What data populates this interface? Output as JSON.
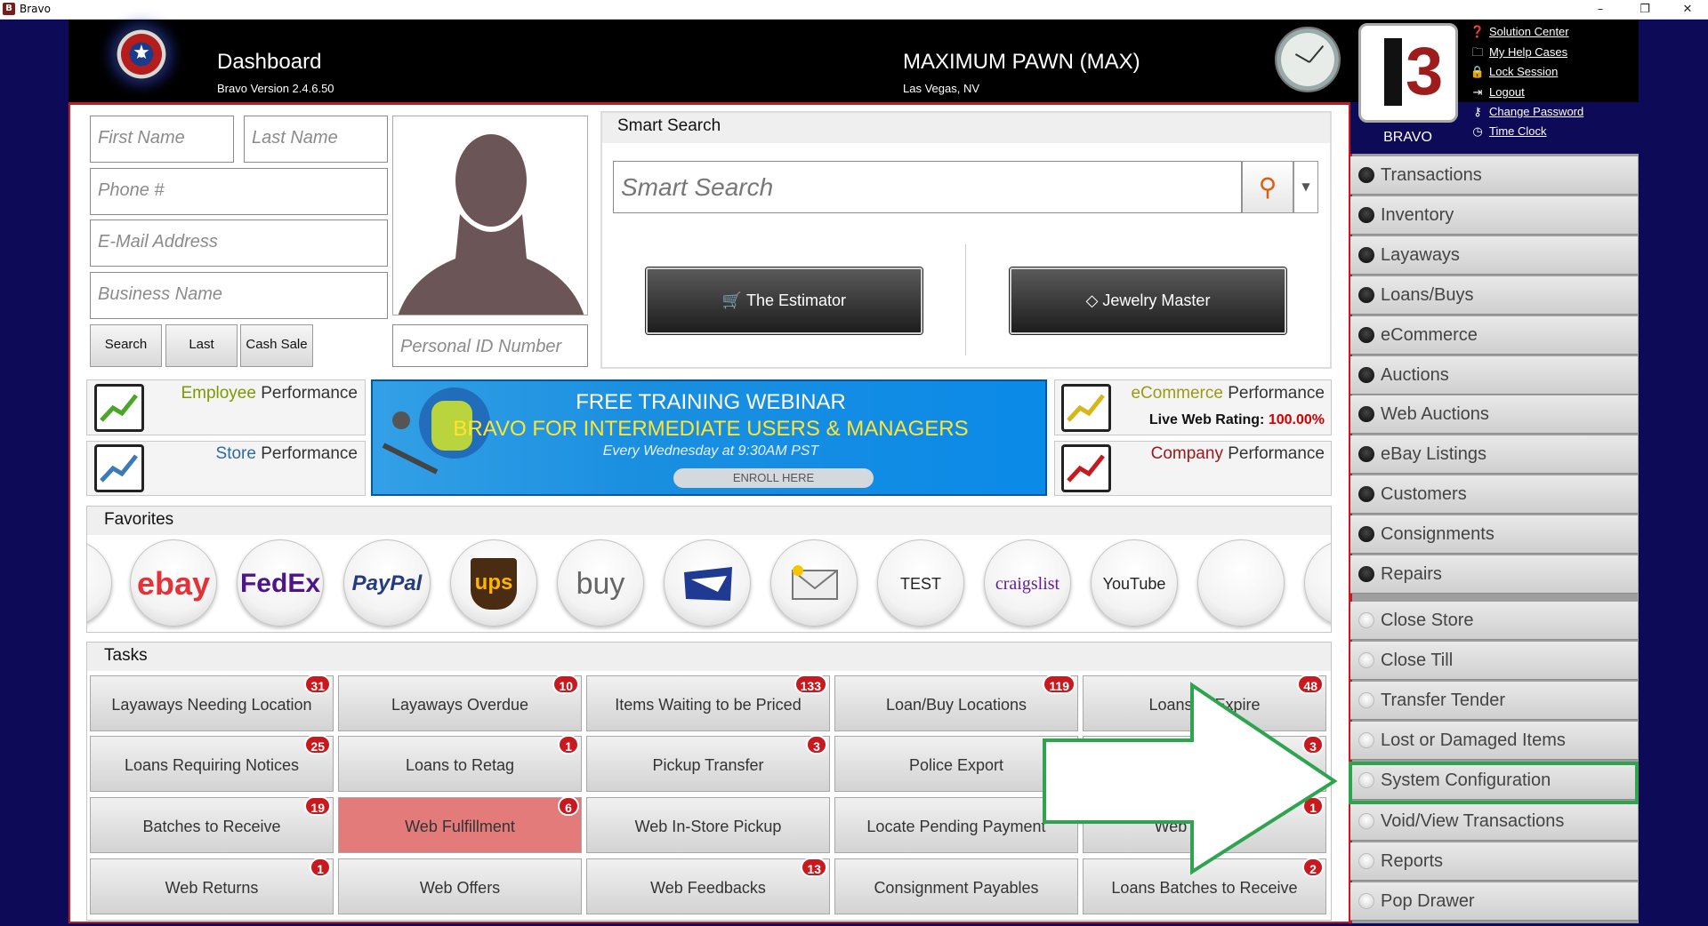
{
  "window": {
    "title": "Bravo",
    "minimize": "–",
    "restore": "❐",
    "close": "✕"
  },
  "header": {
    "dashboard_title": "Dashboard",
    "version": "Bravo Version 2.4.6.50",
    "store_name": "MAXIMUM PAWN (MAX)",
    "store_location": "Las Vegas, NV",
    "brand_label": "BRAVO",
    "links": [
      {
        "label": "Solution Center",
        "icon": "question-icon"
      },
      {
        "label": "My Help Cases",
        "icon": "folder-icon"
      },
      {
        "label": "Lock Session",
        "icon": "lock-icon"
      },
      {
        "label": "Logout",
        "icon": "logout-icon"
      },
      {
        "label": "Change Password",
        "icon": "key-icon"
      },
      {
        "label": "Time Clock",
        "icon": "clock-icon"
      }
    ]
  },
  "customer_search": {
    "first_name_placeholder": "First Name",
    "last_name_placeholder": "Last Name",
    "phone_placeholder": "Phone #",
    "email_placeholder": "E-Mail Address",
    "business_placeholder": "Business Name",
    "personal_id_placeholder": "Personal ID Number",
    "search_button": "Search",
    "last_button": "Last",
    "cash_sale_button": "Cash Sale"
  },
  "smart_search": {
    "title": "Smart Search",
    "placeholder": "Smart Search",
    "estimator_button": "The Estimator",
    "jewelry_button": "Jewelry Master"
  },
  "performance": {
    "employee": {
      "highlight": "Employee",
      "rest": " Performance"
    },
    "store": {
      "highlight": "Store",
      "rest": " Performance"
    },
    "ecommerce": {
      "highlight": "eCommerce",
      "rest": " Performance",
      "rating_label": "Live Web Rating: ",
      "rating_value": "100.00%"
    },
    "company": {
      "highlight": "Company",
      "rest": " Performance"
    }
  },
  "banner": {
    "line1": "FREE TRAINING WEBINAR",
    "line2": "BRAVO FOR INTERMEDIATE USERS & MANAGERS",
    "line3": "Every Wednesday at 9:30AM PST",
    "cta": "ENROLL HERE"
  },
  "favorites": {
    "title": "Favorites",
    "items": [
      {
        "label": "ebay",
        "color": "#e53238"
      },
      {
        "label": "FedEx",
        "color": "#4d148c"
      },
      {
        "label": "PayPal",
        "color": "#253b80"
      },
      {
        "label": "ups",
        "color": "#ffb500"
      },
      {
        "label": "buy",
        "color": "#666666"
      },
      {
        "label": "",
        "icon": "usps-eagle-icon"
      },
      {
        "label": "",
        "icon": "envelope-icon"
      },
      {
        "label": "TEST",
        "color": "#222222"
      },
      {
        "label": "craigslist",
        "color": "#6a1b9a"
      },
      {
        "label": "YouTube",
        "color": "#222222"
      },
      {
        "label": "",
        "icon": "blank-icon"
      }
    ]
  },
  "tasks": {
    "title": "Tasks",
    "rows": [
      [
        {
          "label": "Layaways Needing Location",
          "badge": "31"
        },
        {
          "label": "Layaways Overdue",
          "badge": "10"
        },
        {
          "label": "Items Waiting to be Priced",
          "badge": "133"
        },
        {
          "label": "Loan/Buy Locations",
          "badge": "119"
        },
        {
          "label": "Loans to Expire",
          "badge": "48"
        }
      ],
      [
        {
          "label": "Loans Requiring Notices",
          "badge": "25"
        },
        {
          "label": "Loans to Retag",
          "badge": "1"
        },
        {
          "label": "Pickup Transfer",
          "badge": "3"
        },
        {
          "label": "Police Export",
          "badge": ""
        },
        {
          "label": "",
          "badge": "3"
        }
      ],
      [
        {
          "label": "Batches to Receive",
          "badge": "19"
        },
        {
          "label": "Web Fulfillment",
          "badge": "6",
          "highlight": "#e37b7b"
        },
        {
          "label": "Web In-Store Pickup",
          "badge": ""
        },
        {
          "label": "Locate Pending Payment",
          "badge": ""
        },
        {
          "label": "Web Payment",
          "badge": "1"
        }
      ],
      [
        {
          "label": "Web Returns",
          "badge": "1"
        },
        {
          "label": "Web Offers",
          "badge": ""
        },
        {
          "label": "Web Feedbacks",
          "badge": "13"
        },
        {
          "label": "Consignment Payables",
          "badge": ""
        },
        {
          "label": "Loans Batches to Receive",
          "badge": "2"
        }
      ]
    ]
  },
  "menu": {
    "primary": [
      "Transactions",
      "Inventory",
      "Layaways",
      "Loans/Buys",
      "eCommerce",
      "Auctions",
      "Web Auctions",
      "eBay Listings",
      "Customers",
      "Consignments",
      "Repairs"
    ],
    "secondary": [
      "Close Store",
      "Close Till",
      "Transfer Tender",
      "Lost or Damaged Items",
      "System Configuration",
      "Void/View Transactions",
      "Reports",
      "Pop Drawer"
    ],
    "highlighted": "System Configuration"
  },
  "colors": {
    "accent_red": "#c7191e",
    "highlight_green": "#2ea44f",
    "ecommerce_highlight": "#7a9a01"
  }
}
